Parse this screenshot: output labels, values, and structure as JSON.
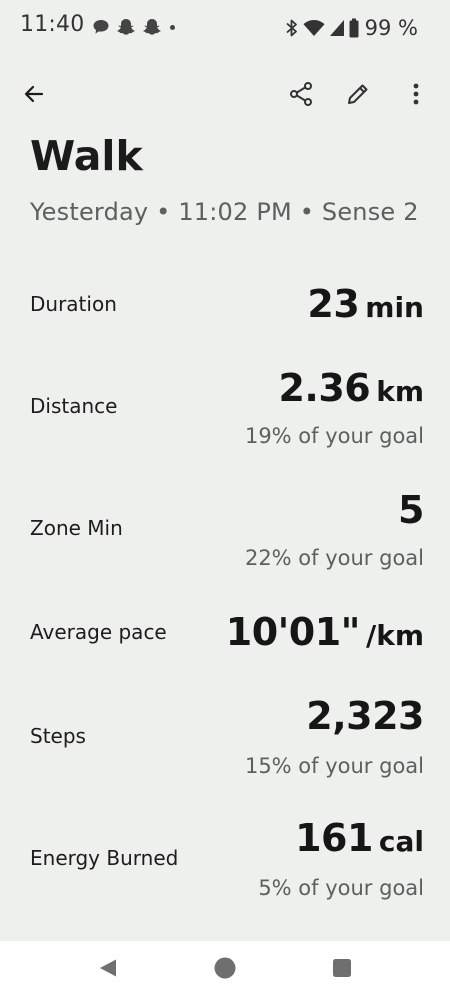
{
  "status_bar": {
    "time": "11:40",
    "battery": "99 %",
    "icons": [
      "chat-bubble-icon",
      "snapchat-icon",
      "snapchat-icon",
      "more-dot-icon",
      "bluetooth-icon",
      "wifi-icon",
      "signal-icon",
      "battery-icon"
    ]
  },
  "app_bar": {
    "icons": [
      "back-arrow-icon",
      "share-icon",
      "edit-icon",
      "more-vert-icon"
    ]
  },
  "header": {
    "title": "Walk",
    "subtitle": "Yesterday • 11:02 PM • Sense 2"
  },
  "stats": [
    {
      "label": "Duration",
      "value": "23",
      "unit": "min",
      "goal": ""
    },
    {
      "label": "Distance",
      "value": "2.36",
      "unit": "km",
      "goal": "19% of your goal"
    },
    {
      "label": "Zone Min",
      "value": "5",
      "unit": "",
      "goal": "22% of your goal"
    },
    {
      "label": "Average pace",
      "value": "10'01\"",
      "unit": "/km",
      "goal": ""
    },
    {
      "label": "Steps",
      "value": "2,323",
      "unit": "",
      "goal": "15% of your goal"
    },
    {
      "label": "Energy Burned",
      "value": "161",
      "unit": "cal",
      "goal": "5% of your goal"
    }
  ],
  "nav_bar": {
    "icons": [
      "nav-back-icon",
      "nav-home-icon",
      "nav-recents-icon"
    ]
  },
  "colors": {
    "background": "#eef0ed",
    "primary_text": "#1c1c1c",
    "secondary_text": "#5d605e",
    "nav_background": "#ffffff"
  }
}
